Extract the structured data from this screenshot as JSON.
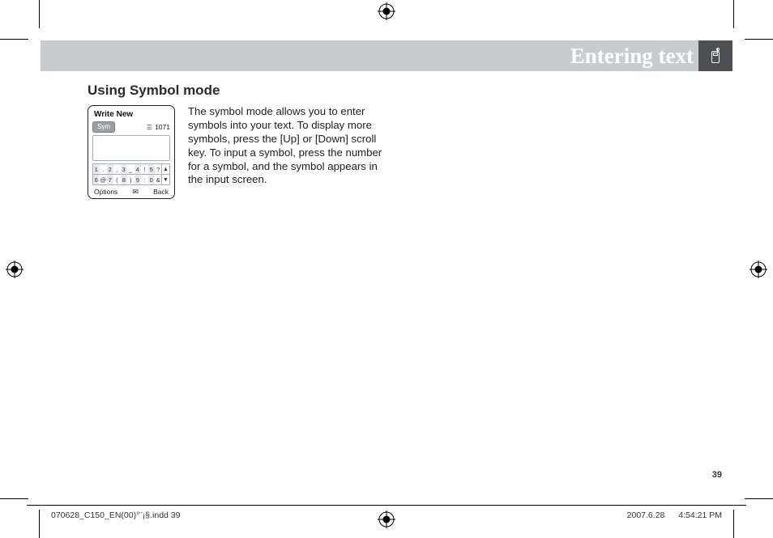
{
  "chapter_title": "Entering text",
  "section_heading": "Using Symbol mode",
  "body": "The symbol mode allows you to enter symbols into your text. To display more symbols, press the [Up] or [Down] scroll key. To input a symbol, press the number for a symbol, and the symbol appears in the input screen.",
  "phone": {
    "title": "Write New",
    "mode_badge": "Sym",
    "count": "1071",
    "soft_left": "Options",
    "soft_right": "Back",
    "sym_row1": [
      "1",
      ".",
      "2",
      ",",
      "3",
      "_",
      "4",
      "!",
      "5",
      "?"
    ],
    "sym_row2": [
      "6",
      "@",
      "7",
      "(",
      "8",
      ")",
      "9",
      ":",
      "0",
      "&"
    ],
    "arrow_up": "▲",
    "arrow_down": "▼",
    "soft_mid_icon": "✉"
  },
  "page_number": "39",
  "footer_left": "070628_C150_EN(00)°¨¡§.indd   39",
  "footer_date": "2007.6.28",
  "footer_time": "4:54:21 PM",
  "chart_data": null
}
